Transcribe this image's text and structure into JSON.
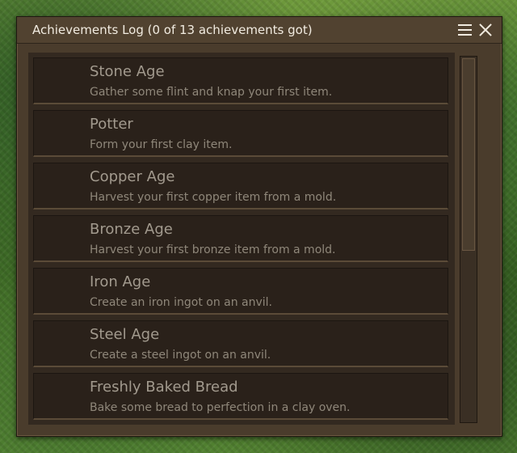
{
  "window": {
    "title": "Achievements Log (0 of 13 achievements got)"
  },
  "titlebar_icons": {
    "menu": "hamburger-menu-icon",
    "close": "close-icon"
  },
  "achievements": [
    {
      "title": "Stone Age",
      "description": "Gather some flint and knap your first item."
    },
    {
      "title": "Potter",
      "description": "Form your first clay item."
    },
    {
      "title": "Copper Age",
      "description": "Harvest your first copper item from a mold."
    },
    {
      "title": "Bronze Age",
      "description": "Harvest your first bronze item from a mold."
    },
    {
      "title": "Iron Age",
      "description": "Create an iron ingot on an anvil."
    },
    {
      "title": "Steel Age",
      "description": "Create a steel ingot on an anvil."
    },
    {
      "title": "Freshly Baked Bread",
      "description": "Bake some bread to perfection in a clay oven."
    }
  ],
  "colors": {
    "panel": "#4a3c2c",
    "item_background": "#2a211a",
    "title_text": "#f1ebe0",
    "item_text": "#a29a8e"
  }
}
